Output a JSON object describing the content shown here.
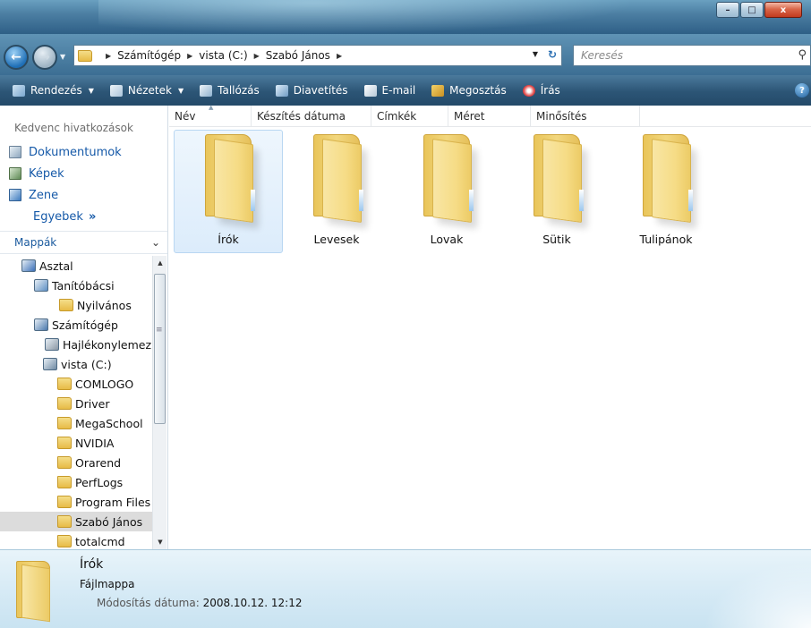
{
  "window": {
    "minimize": "–",
    "maximize": "□",
    "close": "x"
  },
  "address": {
    "crumbs": [
      "Számítógép",
      "vista (C:)",
      "Szabó János"
    ],
    "search_placeholder": "Keresés"
  },
  "toolbar": {
    "organize": "Rendezés",
    "views": "Nézetek",
    "explore": "Tallózás",
    "slideshow": "Diavetítés",
    "email": "E-mail",
    "share": "Megosztás",
    "burn": "Írás",
    "help": "?"
  },
  "favorites": {
    "header": "Kedvenc hivatkozások",
    "items": [
      "Dokumentumok",
      "Képek",
      "Zene"
    ],
    "more": "Egyebek",
    "more_arrow": "»"
  },
  "folders_pane": {
    "header": "Mappák",
    "tree": [
      {
        "label": "Asztal",
        "icon": "desktop-icon",
        "color": "#3a6fb8"
      },
      {
        "label": "Tanítóbácsi",
        "icon": "user-folder-icon",
        "color": "#5d8fc4"
      },
      {
        "label": "Nyilvános",
        "icon": "folder-icon",
        "color": "#e7bb47"
      },
      {
        "label": "Számítógép",
        "icon": "computer-icon",
        "color": "#4a78ad"
      },
      {
        "label": "Hajlékonylemez",
        "icon": "floppy-drive-icon",
        "color": "#8a96a3"
      },
      {
        "label": "vista (C:)",
        "icon": "hard-drive-icon",
        "color": "#6f8aa3"
      },
      {
        "label": "COMLOGO",
        "icon": "folder-icon",
        "color": "#e7bb47"
      },
      {
        "label": "Driver",
        "icon": "folder-icon",
        "color": "#e7bb47"
      },
      {
        "label": "MegaSchool",
        "icon": "folder-icon",
        "color": "#e7bb47"
      },
      {
        "label": "NVIDIA",
        "icon": "folder-icon",
        "color": "#e7bb47"
      },
      {
        "label": "Orarend",
        "icon": "folder-icon",
        "color": "#e7bb47"
      },
      {
        "label": "PerfLogs",
        "icon": "folder-icon",
        "color": "#e7bb47"
      },
      {
        "label": "Program Files",
        "icon": "folder-icon",
        "color": "#e7bb47"
      },
      {
        "label": "Szabó János",
        "icon": "folder-icon",
        "color": "#e7bb47"
      },
      {
        "label": "totalcmd",
        "icon": "folder-icon",
        "color": "#e7bb47"
      }
    ]
  },
  "columns": [
    "Név",
    "Készítés dátuma",
    "Címkék",
    "Méret",
    "Minősítés"
  ],
  "files": [
    "Írók",
    "Levesek",
    "Lovak",
    "Sütik",
    "Tulipánok"
  ],
  "details": {
    "name": "Írók",
    "type": "Fájlmappa",
    "modified_label": "Módosítás dátuma:",
    "modified_value": "2008.10.12. 12:12"
  }
}
